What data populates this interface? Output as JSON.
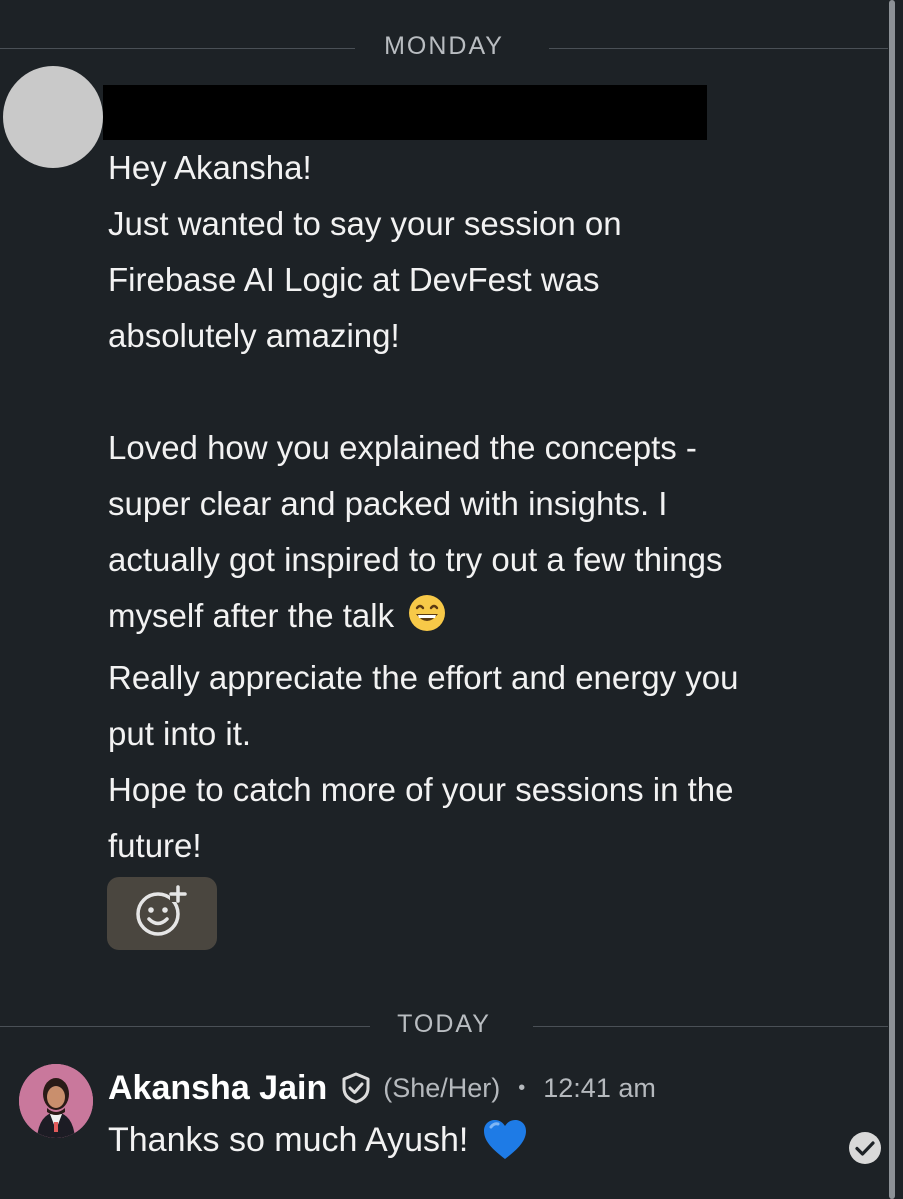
{
  "dividers": {
    "first": "MONDAY",
    "second": "TODAY"
  },
  "incoming_message": {
    "sender_avatar": "avatar-placeholder",
    "sender_name_redacted": true,
    "lines": [
      "Hey Akansha!",
      "Just wanted to say your session on",
      "Firebase AI Logic at DevFest was",
      "absolutely amazing!",
      "",
      "Loved how you explained the concepts -",
      "super clear and packed with insights. I",
      "actually got inspired to try out a few things",
      "myself after the talk",
      "Really appreciate the effort and energy you",
      "put into it.",
      "Hope to catch more of your sessions in the",
      "future!"
    ],
    "emoji_after_line_8": "grinning-face-emoji",
    "reaction_icon": "add-reaction-icon"
  },
  "reply": {
    "sender_name": "Akansha Jain",
    "verified_icon": "verified-shield-icon",
    "pronouns": "(She/Her)",
    "separator": "•",
    "time": "12:41 am",
    "text": "Thanks so much Ayush!",
    "emoji": "blue-heart-emoji",
    "status_icon": "read-receipt-check-icon"
  },
  "colors": {
    "background": "#1d2226",
    "reaction_button": "#4a463f",
    "muted_text": "#b5b9bd",
    "heart": "#1e7be6"
  }
}
